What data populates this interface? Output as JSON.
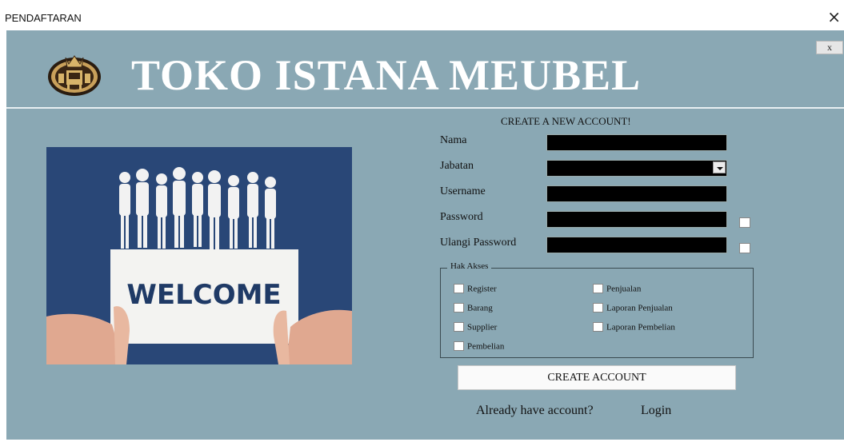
{
  "window": {
    "title": "PENDAFTARAN",
    "close_glyph": "×"
  },
  "form": {
    "close_button": "x",
    "brand": "TOKO ISTANA MEUBEL",
    "logo_icon": "crown-furniture-logo",
    "image": {
      "text": "WELCOME",
      "description_icon": "welcome-people-photo"
    },
    "heading": "CREATE A NEW ACCOUNT!",
    "fields": {
      "nama": {
        "label": "Nama",
        "value": ""
      },
      "jabatan": {
        "label": "Jabatan",
        "value": ""
      },
      "username": {
        "label": "Username",
        "value": ""
      },
      "password": {
        "label": "Password",
        "value": ""
      },
      "ulangi_password": {
        "label": "Ulangi Password",
        "value": ""
      }
    },
    "hak_akses": {
      "legend": "Hak Akses",
      "left": [
        "Register",
        "Barang",
        "Supplier",
        "Pembelian"
      ],
      "right": [
        "Penjualan",
        "Laporan Penjualan",
        "Laporan Pembelian"
      ]
    },
    "create_button": "CREATE ACCOUNT",
    "already_text": "Already have account?",
    "login_link": "Login"
  },
  "colors": {
    "form_bg": "#8aa8b4",
    "field_bg": "#000000",
    "brand_text": "#ffffff",
    "photo_bg": "#2f4f80"
  }
}
